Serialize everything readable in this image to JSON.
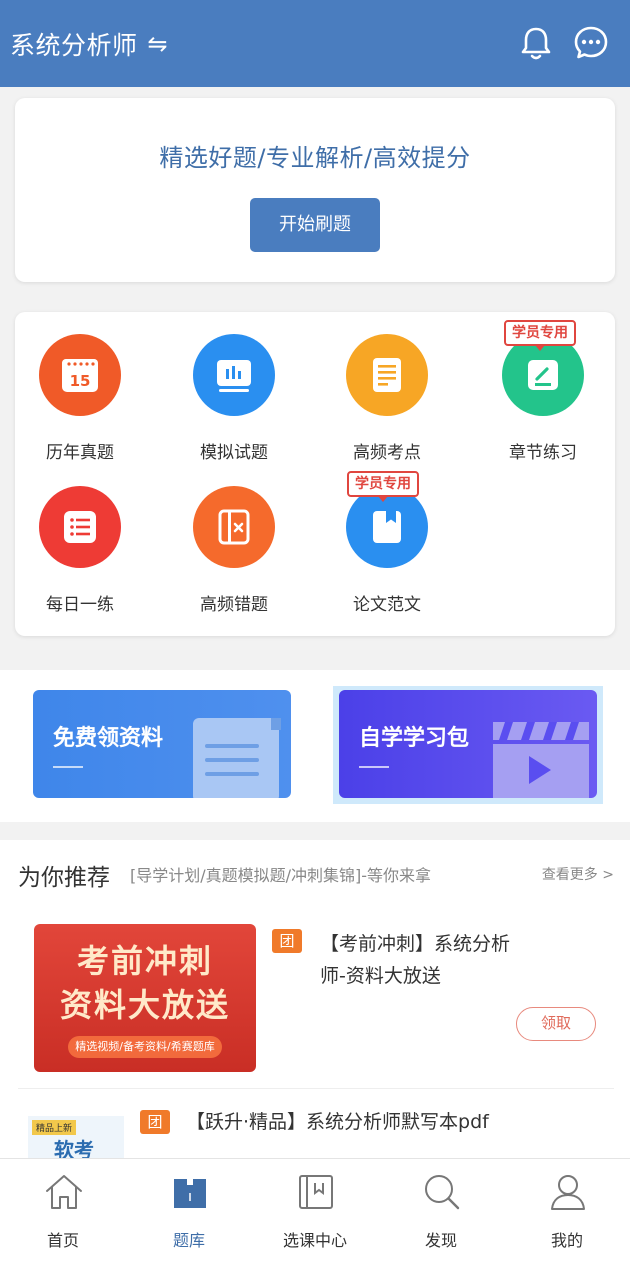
{
  "header": {
    "title": "系统分析师",
    "swap_icon": "⇋",
    "icons": [
      "bell-icon",
      "chat-bubble-icon"
    ]
  },
  "hero": {
    "slogan": "精选好题/专业解析/高效提分",
    "start_button": "开始刷题"
  },
  "colors": {
    "primary": "#4a7dbf",
    "badge_red": "#e0463f"
  },
  "grid": {
    "items": [
      {
        "label": "历年真题",
        "icon": "calendar-icon",
        "color": "#f05a28",
        "calendar_day": "15",
        "badge": ""
      },
      {
        "label": "模拟试题",
        "icon": "chart-board-icon",
        "color": "#2a8ff0",
        "badge": ""
      },
      {
        "label": "高频考点",
        "icon": "document-list-icon",
        "color": "#f7a625",
        "badge": ""
      },
      {
        "label": "章节练习",
        "icon": "edit-icon",
        "color": "#23c48b",
        "badge": "学员专用"
      },
      {
        "label": "每日一练",
        "icon": "list-icon",
        "color": "#ee3b35",
        "badge": ""
      },
      {
        "label": "高频错题",
        "icon": "wrong-book-icon",
        "color": "#f56a2c",
        "badge": ""
      },
      {
        "label": "论文范文",
        "icon": "bookmark-book-icon",
        "color": "#2a8ff0",
        "badge": "学员专用"
      }
    ]
  },
  "promos": [
    {
      "title": "免费领资料",
      "icon": "document-icon",
      "color": "#3d83e6"
    },
    {
      "title": "自学学习包",
      "icon": "video-clapper-icon",
      "color": "#5a4ef0"
    }
  ],
  "recommend": {
    "heading": "为你推荐",
    "subheading": "[导学计划/真题模拟题/冲刺集锦]-等你来拿",
    "more": "查看更多 >",
    "items": [
      {
        "tag": "团",
        "title_line1": "【考前冲刺】系统分析",
        "title_line2": "师-资料大放送",
        "image_line1": "考前冲刺",
        "image_line2": "资料大放送",
        "image_line3": "精选视频/备考资料/希赛题库",
        "action": "领取"
      },
      {
        "tag": "团",
        "title": "【跃升·精品】系统分析师默写本pdf",
        "thumb_tag": "精品上新",
        "thumb_text": "软考"
      }
    ]
  },
  "tabbar": {
    "items": [
      {
        "label": "首页",
        "icon": "home-icon",
        "active": false
      },
      {
        "label": "题库",
        "icon": "question-bank-icon",
        "active": true
      },
      {
        "label": "选课中心",
        "icon": "course-center-icon",
        "active": false
      },
      {
        "label": "发现",
        "icon": "search-discover-icon",
        "active": false
      },
      {
        "label": "我的",
        "icon": "user-icon",
        "active": false
      }
    ]
  }
}
